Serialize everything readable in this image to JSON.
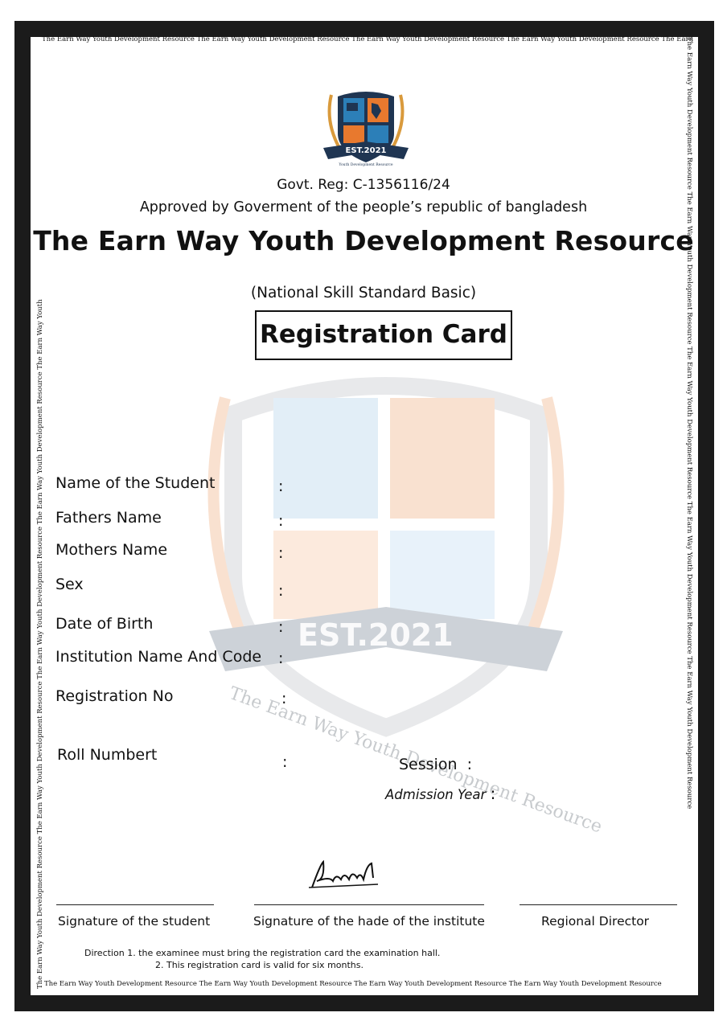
{
  "border": {
    "top": "The Earn Way Youth Development Resource The Earn Way Youth Development Resource The Earn Way Youth Development Resource The Earn Way Youth Development Resource The Earn",
    "bottom": "The Earn Way Youth Development Resource   The Earn Way Youth Development Resource      The Earn Way Youth Development Resource    The Earn Way Youth Development Resource",
    "left": "The Earn Way Youth Development Resource  The Earn Way Youth Development Resource  The Earn Way Youth Development Resource  The Earn Way Youth Development Resource  The Earn Way Youth",
    "right": "The Earn Way Youth Development Resource The Earn Way Youth Development Resource The Earn Way Youth Development Resource The Earn Way Youth Development Resource The Earn Way Youth Development Resource"
  },
  "logo": {
    "est": "EST.2021",
    "ring": "Youth Development Resource"
  },
  "watermark": {
    "est": "EST.2021",
    "arc": "The Earn Way Youth Development Resource"
  },
  "header": {
    "reg": "Govt. Reg: C-1356116/24",
    "approved": "Approved by Goverment of the people’s republic of bangladesh",
    "title": "The Earn Way Youth Development Resource",
    "subtitle": "(National Skill Standard Basic)",
    "card": "Registration Card"
  },
  "fields": {
    "student": "Name of the Student",
    "father": "Fathers Name",
    "mother": "Mothers Name",
    "sex": "Sex",
    "dob": "Date of Birth",
    "institution": "Institution Name And Code",
    "regno": "Registration No",
    "roll": "Roll Numbert",
    "session": "Session",
    "admission": "Admission Year",
    "colon": ":"
  },
  "signatures": {
    "student": "Signature of the student",
    "head": "Signature of the hade of the institute",
    "director": "Regional Director"
  },
  "directions": {
    "line1": "Direction 1. the examinee must bring the registration card the examination hall.",
    "line2": "2. This registration card is valid for six months."
  },
  "colors": {
    "orange": "#e8792e",
    "blue": "#2c7fb8",
    "navy": "#1f3552",
    "gold": "#d99a3c"
  }
}
